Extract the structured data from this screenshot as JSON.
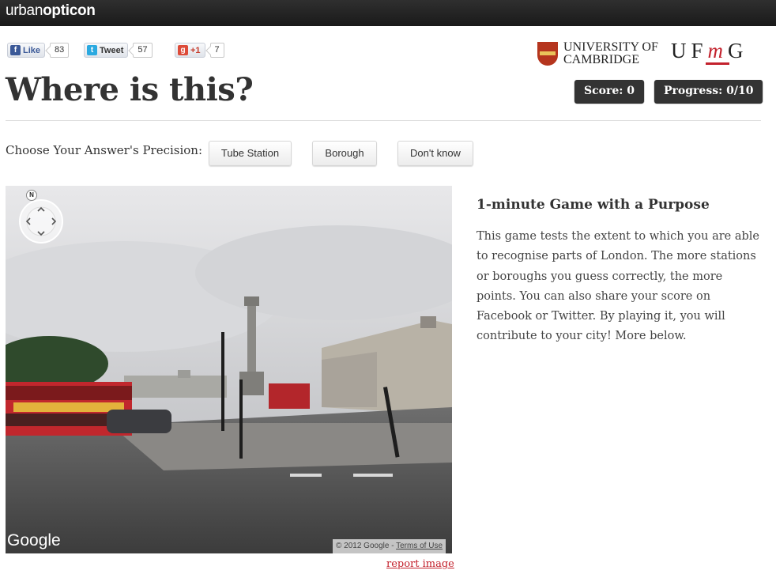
{
  "header": {
    "brand_light": "urban",
    "brand_bold": "opticon"
  },
  "social": {
    "facebook": {
      "label": "Like",
      "count": "83",
      "icon": "facebook-icon"
    },
    "twitter": {
      "label": "Tweet",
      "count": "57",
      "icon": "twitter-bird-icon"
    },
    "gplus": {
      "label": "+1",
      "count": "7",
      "icon": "google-plus-icon"
    }
  },
  "logos": {
    "cambridge_line1": "UNIVERSITY OF",
    "cambridge_line2": "CAMBRIDGE",
    "ufmg_u": "U",
    "ufmg_f": "F",
    "ufmg_m": "m",
    "ufmg_g": "G"
  },
  "page": {
    "title": "Where is this?"
  },
  "score": {
    "label": "Score: 0"
  },
  "progress": {
    "label": "Progress: 0/10"
  },
  "precision": {
    "label": "Choose Your Answer's Precision:",
    "options": [
      "Tube Station",
      "Borough",
      "Don't know"
    ]
  },
  "streetview": {
    "compass_label": "N",
    "google_logo": "Google",
    "copyright": "© 2012 Google - ",
    "terms": "Terms of Use",
    "report": "report image"
  },
  "sidebar": {
    "heading": "1-minute Game with a Purpose",
    "body": "This game tests the extent to which you are able to recognise parts of London. The more stations or boroughs you guess correctly, the more points. You can also share your score on Facebook or Twitter. By playing it, you will contribute to your city! More below."
  },
  "colors": {
    "topbar": "#1f1f1f",
    "accent_red": "#c3222d",
    "pill_bg": "#333333"
  }
}
